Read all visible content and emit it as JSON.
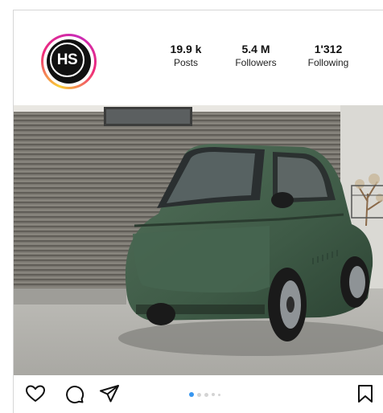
{
  "profile": {
    "avatar_initials": "HS",
    "stats": [
      {
        "value": "19.9 k",
        "label": "Posts"
      },
      {
        "value": "5.4 M",
        "label": "Followers"
      },
      {
        "value": "1'312",
        "label": "Following"
      }
    ]
  },
  "post": {
    "image_alt": "green microcar parked in front of a wooden slatted wall",
    "carousel": {
      "total_dots": 5,
      "active_index": 0
    }
  },
  "actions": {
    "like_icon": "heart-icon",
    "comment_icon": "comment-bubble-icon",
    "share_icon": "paper-plane-icon",
    "save_icon": "bookmark-icon"
  },
  "colors": {
    "accent": "#3897f0",
    "ring_gradient": [
      "#f9ce34",
      "#ee2a7b",
      "#c92bb7"
    ],
    "car_green": "#3f5b47"
  }
}
